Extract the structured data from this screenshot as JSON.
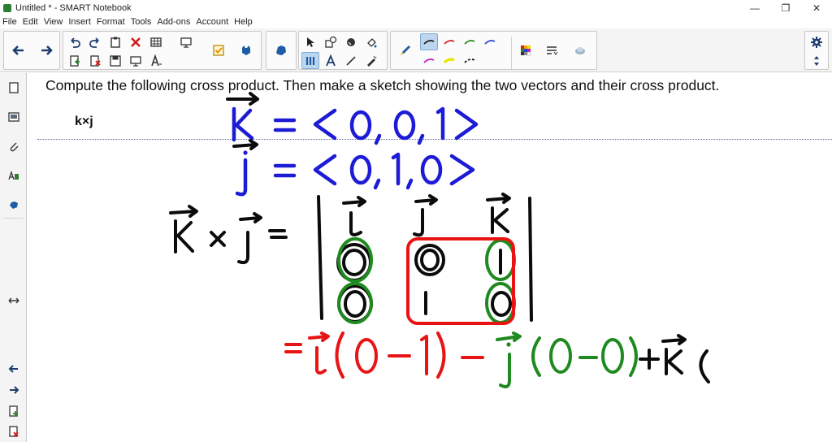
{
  "window": {
    "title": "Untitled * - SMART Notebook",
    "controls": [
      "—",
      "❐",
      "✕"
    ]
  },
  "menu": [
    "File",
    "Edit",
    "View",
    "Insert",
    "Format",
    "Tools",
    "Add-ons",
    "Account",
    "Help"
  ],
  "toolbar_icons": [
    "back-icon",
    "forward-icon",
    "undo-icon",
    "redo-icon",
    "paste-icon",
    "delete-icon",
    "table-icon",
    "screen-icon",
    "insert-page-icon",
    "delete-page-icon",
    "save-icon",
    "presentation-icon",
    "text-format-icon",
    "response-icon",
    "addon-icon",
    "shape-recognition-icon",
    "select-icon",
    "shapes-icon",
    "eraser-icon",
    "fill-icon",
    "pen-icon",
    "text-icon",
    "line-icon",
    "magic-pen-icon",
    "pen-style-icon",
    "color-palette-icon",
    "line-style-icon",
    "properties-icon",
    "gear-icon",
    "updown-icon"
  ],
  "pen_colors": [
    "#1a1a1a",
    "#d42020",
    "#1f8a1f",
    "#2b3dd6",
    "#c018c0",
    "#e6e600",
    "#1a1a1a"
  ],
  "colors": {
    "blue_ink": "#1c1cd6",
    "black_ink": "#0b0b0b",
    "red_ink": "#e81414",
    "green_ink": "#1f8a1f"
  },
  "sidebar_icons": [
    "page-sorter-icon",
    "gallery-icon",
    "attachments-icon",
    "properties-icon",
    "addons-icon",
    "resize-icon",
    "prev-page-icon",
    "next-page-icon",
    "add-page-icon",
    "delete-page-icon"
  ],
  "page": {
    "question": "Compute the following cross product. Then make a sketch showing the two vectors and their cross product.",
    "label": "k×j"
  }
}
